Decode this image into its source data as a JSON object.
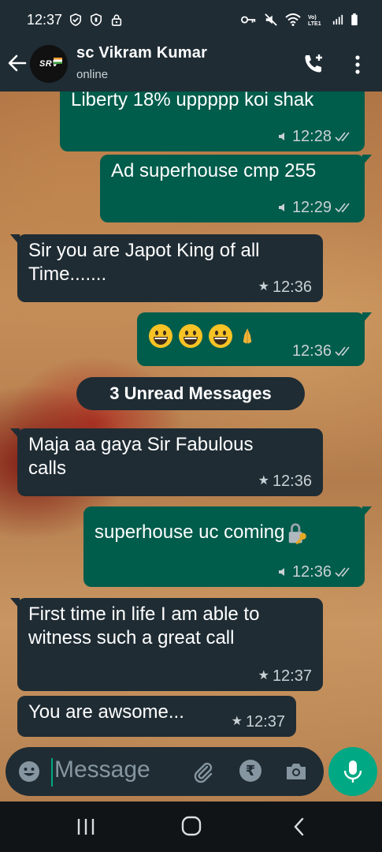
{
  "status_bar": {
    "time": "12:37"
  },
  "header": {
    "contact_name": "sc Vikram Kumar",
    "status": "online",
    "avatar_text": "SRV"
  },
  "messages": [
    {
      "dir": "out",
      "text": "Liberty 18% uppppp koi shak",
      "time": "12:28",
      "icon": "mic-icon",
      "receipt": "double-tick-icon"
    },
    {
      "dir": "out",
      "text": "Ad superhouse cmp 255",
      "time": "12:29",
      "icon": "mic-icon",
      "receipt": "double-tick-icon"
    },
    {
      "dir": "in",
      "text": "Sir you are Japot King of all Time.......",
      "time": "12:36",
      "icon": "star-icon"
    },
    {
      "dir": "out",
      "text": "",
      "emojis": [
        "grinning-face-emoji",
        "grinning-face-emoji",
        "grinning-face-emoji",
        "folded-hands-emoji"
      ],
      "time": "12:36",
      "receipt": "double-tick-icon"
    },
    {
      "dir": "in",
      "text": "Maja aa gaya Sir Fabulous calls",
      "time": "12:36",
      "icon": "star-icon"
    },
    {
      "dir": "out",
      "text": "superhouse uc coming",
      "emoji_suffix": "locked-with-key-emoji",
      "time": "12:36",
      "icon": "mic-icon",
      "receipt": "double-tick-icon"
    },
    {
      "dir": "in",
      "text": "First time in life I am able to witness such a great call",
      "time": "12:37",
      "icon": "star-icon"
    },
    {
      "dir": "in",
      "text": "You are awsome...",
      "time": "12:37",
      "icon": "star-icon"
    }
  ],
  "unread_banner": "3 Unread Messages",
  "composer": {
    "placeholder": "Message"
  },
  "colors": {
    "outgoing_bubble": "#005c4b",
    "incoming_bubble": "#1f2c34",
    "accent": "#00a884",
    "header": "#1f2c34"
  }
}
